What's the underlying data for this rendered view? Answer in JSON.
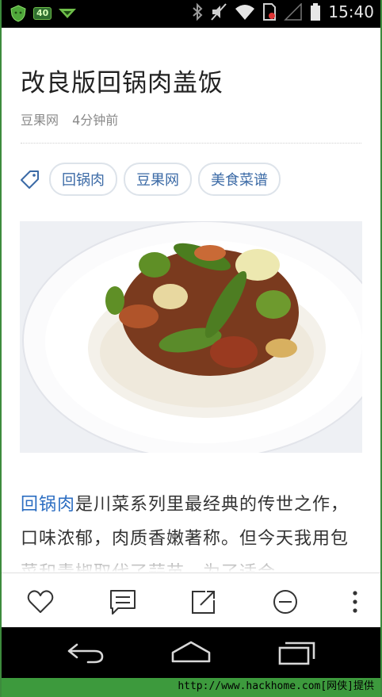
{
  "status_bar": {
    "time": "15:40",
    "notification_badge": "40",
    "icons": [
      "android-shield-icon",
      "badge-icon",
      "downloads-icon",
      "bluetooth-icon",
      "mute-icon",
      "wifi-icon",
      "no-sim-icon",
      "signal-icon",
      "battery-icon"
    ]
  },
  "article": {
    "title": "改良版回锅肉盖饭",
    "source": "豆果网",
    "time_ago": "4分钟前",
    "tags": [
      "回锅肉",
      "豆果网",
      "美食菜谱"
    ],
    "body_link": "回锅肉",
    "body_text": "是川菜系列里最经典的传世之作，口味浓郁，肉质香嫩著称。但今天我用包菜和青椒取代了蒜苗，为了适合"
  },
  "action_bar": {
    "icons": [
      "heart-icon",
      "comment-icon",
      "share-icon",
      "minus-circle-icon",
      "more-icon"
    ]
  },
  "nav_bar": {
    "icons": [
      "back-icon",
      "home-icon",
      "recents-icon"
    ]
  },
  "footer": {
    "text": "http://www.hackhome.com[网侠]提供"
  },
  "colors": {
    "accent": "#2c6ec2",
    "frame": "#3d8b3d"
  }
}
